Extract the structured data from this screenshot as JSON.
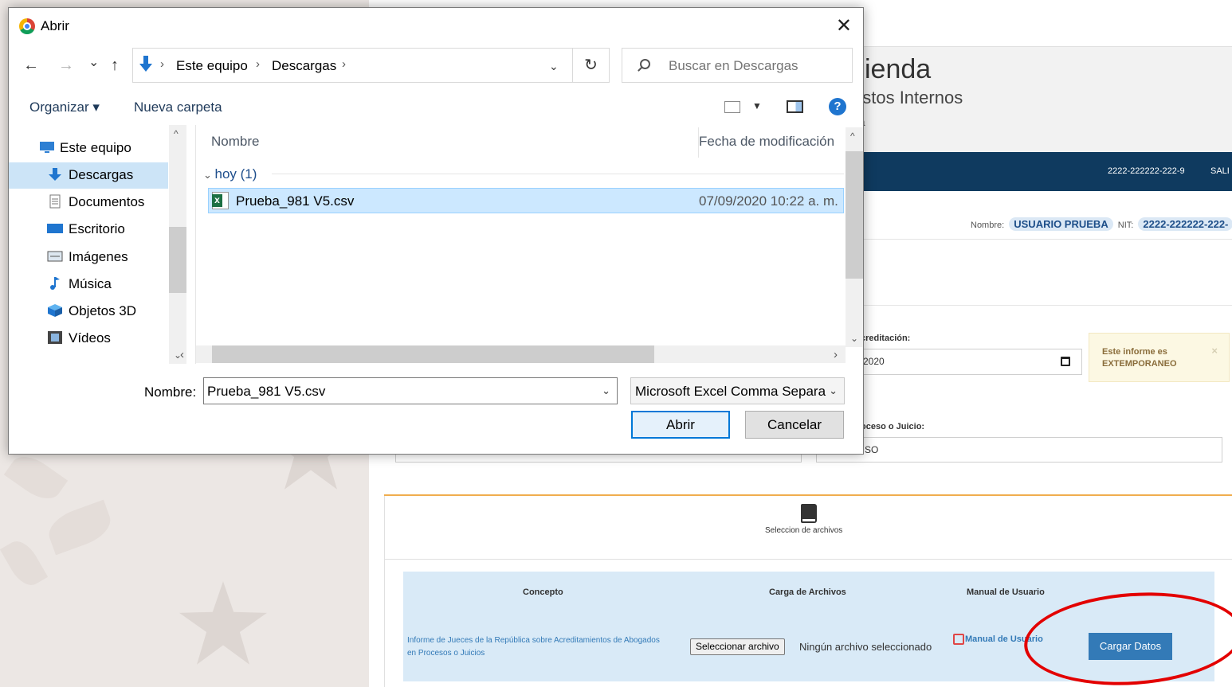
{
  "background": {
    "header_title": "cienda",
    "header_subtitle": "estos Internos",
    "header_subtitle2": "ea",
    "nav_nit": "2222-222222-222-9",
    "nav_exit": "SALI",
    "user_name_label": "Nombre:",
    "user_name_value": "USUARIO PRUEBA",
    "user_nit_label": "NIT:",
    "user_nit_value": "2222-222222-222-",
    "accreditation_label": "creditación:",
    "date_value": "2020",
    "warning_text": "Este informe es EXTEMPORANEO",
    "warning_close": "×",
    "process_label": "oceso o Juicio:",
    "process_value": "SO",
    "files_section_label": "Seleccion de archivos",
    "table": {
      "col_concepto": "Concepto",
      "col_carga": "Carga de Archivos",
      "col_manual": "Manual de Usuario",
      "concept_text": "Informe de Jueces de la República sobre Acreditamientos de Abogados en Procesos o Juicios",
      "file_button": "Seleccionar archivo",
      "file_none": "Ningún archivo seleccionado",
      "manual_link": "Manual de Usuario",
      "cargar_button": "Cargar Datos"
    },
    "colors": {
      "nav": "#0f3a5f",
      "accent": "#337ab7",
      "highlight_ellipse": "#e30000"
    }
  },
  "dialog": {
    "title": "Abrir",
    "close": "✕",
    "nav": {
      "back": "←",
      "forward": "→",
      "recent": "⌄",
      "up": "↑"
    },
    "breadcrumb": [
      "Este equipo",
      "Descargas"
    ],
    "breadcrumb_sep": "›",
    "address_dropdown": "⌄",
    "refresh": "↻",
    "search_placeholder": "Buscar en Descargas",
    "toolbar": {
      "organize": "Organizar ▾",
      "new_folder": "Nueva carpeta",
      "help": "?"
    },
    "sidebar": [
      {
        "label": "Este equipo",
        "icon": "computer-icon"
      },
      {
        "label": "Descargas",
        "icon": "downloads-icon",
        "selected": true
      },
      {
        "label": "Documentos",
        "icon": "documents-icon"
      },
      {
        "label": "Escritorio",
        "icon": "desktop-icon"
      },
      {
        "label": "Imágenes",
        "icon": "pictures-icon"
      },
      {
        "label": "Música",
        "icon": "music-icon"
      },
      {
        "label": "Objetos 3D",
        "icon": "3d-objects-icon"
      },
      {
        "label": "Vídeos",
        "icon": "videos-icon"
      }
    ],
    "columns": {
      "name": "Nombre",
      "date": "Fecha de modificación"
    },
    "group": "hoy (1)",
    "files": [
      {
        "name": "Prueba_981 V5.csv",
        "date": "07/09/2020 10:22 a. m.",
        "icon": "excel-csv-icon"
      }
    ],
    "filename_label": "Nombre:",
    "filename_value": "Prueba_981 V5.csv",
    "filetype_value": "Microsoft Excel Comma Separa",
    "open_button": "Abrir",
    "cancel_button": "Cancelar"
  }
}
